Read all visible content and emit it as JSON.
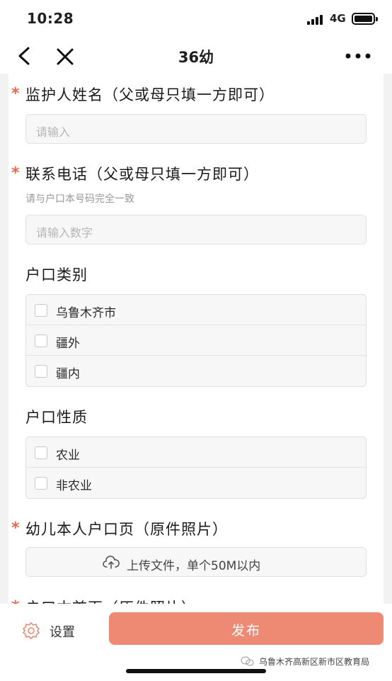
{
  "status_bar": {
    "time": "10:28",
    "network": "4G"
  },
  "nav": {
    "title": "36幼"
  },
  "form": {
    "guardian_name": {
      "label": "监护人姓名（父或母只填一方即可）",
      "required_mark": "*",
      "placeholder": "请输入"
    },
    "phone": {
      "label": "联系电话（父或母只填一方即可）",
      "required_mark": "*",
      "hint": "请与户口本号码完全一致",
      "placeholder": "请输入数字"
    },
    "hukou_type": {
      "label": "户口类别",
      "options": [
        "乌鲁木齐市",
        "疆外",
        "疆内"
      ]
    },
    "hukou_nature": {
      "label": "户口性质",
      "options": [
        "农业",
        "非农业"
      ]
    },
    "child_hukou_page": {
      "label": "幼儿本人户口页（原件照片）",
      "required_mark": "*",
      "upload_label": "上传文件，单个50M以内"
    },
    "hukou_cover": {
      "label": "户口本首页（原件照片）",
      "required_mark": "*"
    }
  },
  "bottom_bar": {
    "settings_label": "设置",
    "publish_label": "发布",
    "watermark": "乌鲁木齐高新区新市区教育局"
  },
  "colors": {
    "accent": "#ee8a74",
    "required": "#e8694a"
  }
}
